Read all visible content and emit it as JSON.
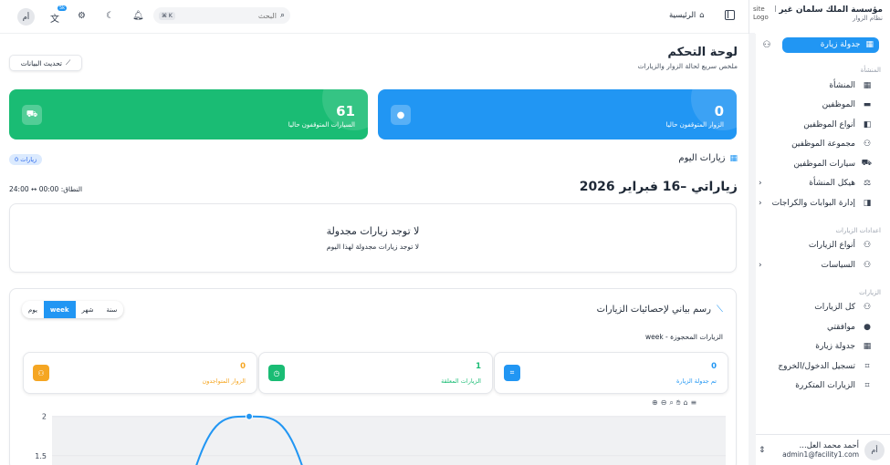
{
  "sidebar": {
    "brand_title": "مؤسسة الملك سلمان غير الربحية",
    "brand_sub": "نظام الزوار",
    "logo_alt": "site Logo",
    "primary_button": "جدولة زيارة",
    "sections": [
      {
        "title": "المنشأة",
        "items": [
          {
            "label": "المنشأة",
            "icon": "building-icon",
            "glyph": "▦",
            "chevron": false
          },
          {
            "label": "الموظفين",
            "icon": "id-card-icon",
            "glyph": "▬",
            "chevron": false
          },
          {
            "label": "أنواع الموظفين",
            "icon": "user-tag-icon",
            "glyph": "◧",
            "chevron": false
          },
          {
            "label": "مجموعة الموظفين",
            "icon": "users-group-icon",
            "glyph": "⚇",
            "chevron": false
          },
          {
            "label": "سيارات الموظفين",
            "icon": "car-icon",
            "glyph": "⛟",
            "chevron": false
          },
          {
            "label": "هيكل المنشأة",
            "icon": "scale-icon",
            "glyph": "⚖",
            "chevron": true
          },
          {
            "label": "إدارة البوابات والكراجات",
            "icon": "gate-icon",
            "glyph": "◨",
            "chevron": true
          }
        ]
      },
      {
        "title": "اعدادات الزيارات",
        "items": [
          {
            "label": "أنواع الزيارات",
            "icon": "user-settings-icon",
            "glyph": "⚇",
            "chevron": false
          },
          {
            "label": "السياسات",
            "icon": "user-shield-icon",
            "glyph": "⚇",
            "chevron": true
          }
        ]
      },
      {
        "title": "الزيارات",
        "items": [
          {
            "label": "كل الزيارات",
            "icon": "users-icon",
            "glyph": "⚇",
            "chevron": false
          },
          {
            "label": "موافقتي",
            "icon": "user-check-icon",
            "glyph": "●",
            "chevron": false
          },
          {
            "label": "جدولة زيارة",
            "icon": "calendar-icon",
            "glyph": "▦",
            "chevron": false
          },
          {
            "label": "تسجيل الدخول/الخروج",
            "icon": "scan-icon",
            "glyph": "⌗",
            "chevron": false
          },
          {
            "label": "الزيارات المتكررة",
            "icon": "repeat-scan-icon",
            "glyph": "⌗",
            "chevron": false
          }
        ]
      }
    ],
    "user_initials": "أم",
    "user_name": "أحمد محمد العل...",
    "user_email": "admin1@facility1.com"
  },
  "topbar": {
    "avatar": "أم",
    "notif_count": "5k",
    "search_placeholder": "البحث",
    "kbd": "⌘ K",
    "home_label": "الرئيسية"
  },
  "main": {
    "title": "لوحة التحكم",
    "subtitle": "ملخص سريع لحالة الزوار والزيارات",
    "refresh_label": "تحديث البيانات",
    "cards": {
      "visitors_now": {
        "value": "0",
        "label": "الزوار المتوقفون حاليا"
      },
      "cars_now": {
        "value": "61",
        "label": "السيارات المتوقفون حاليا"
      }
    },
    "today_title": "زيارات اليوم",
    "visits_count_badge": "0 زيارات",
    "day_title": "زياراتي –16 فبراير 2026",
    "range_label": "النطاق: 00:00 ↔ 24:00",
    "empty_title": "لا توجد زيارات مجدولة",
    "empty_sub": "لا توجد زيارات مجدولة لهذا اليوم",
    "stats_title": "رسم بياني لإحصائيات الزيارات",
    "period_tabs": [
      "يوم",
      "week",
      "شهر",
      "سنة"
    ],
    "active_tab": "week",
    "booked_label": "الزيارات المحجوزة - week",
    "mini_cards": {
      "scheduled": {
        "value": "0",
        "label": "تم جدولة الزيارة"
      },
      "pending": {
        "value": "1",
        "label": "الزيارات المعلقة"
      },
      "present": {
        "value": "0",
        "label": "الزوار المتواجدون"
      }
    }
  },
  "chart_data": {
    "type": "line",
    "title": "",
    "xlabel": "",
    "ylabel": "",
    "y_ticks": [
      "2",
      "1.5"
    ],
    "ylim": [
      1.3,
      2.02
    ],
    "series": [
      {
        "values": [
          1.3,
          2,
          1.3
        ]
      }
    ],
    "color": "#2196f3"
  }
}
